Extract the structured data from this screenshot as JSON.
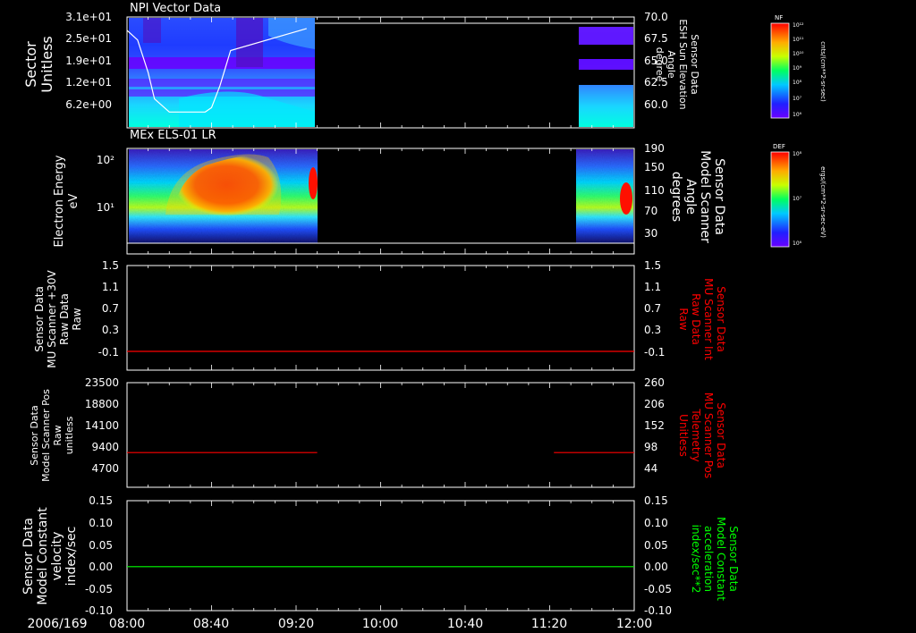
{
  "date_label": "2006/169",
  "x_axis": {
    "start": "08:00",
    "end": "12:00",
    "ticks": [
      "08:00",
      "08:40",
      "09:20",
      "10:00",
      "10:40",
      "11:20",
      "12:00"
    ]
  },
  "panels": [
    {
      "id": "npi",
      "title": "NPI Vector Data",
      "left_label": [
        "Sector",
        "Unitless"
      ],
      "left_ticks": [
        "3.1e+01",
        "2.5e+01",
        "1.9e+01",
        "1.2e+01",
        "6.2e+00"
      ],
      "right_label": [
        "Sensor Data",
        "ESH Sun Elevation",
        "Angle",
        "degree"
      ],
      "right_ticks": [
        "70.0",
        "67.5",
        "65.0",
        "62.5",
        "60.0"
      ],
      "colorbar": {
        "label": "NF",
        "units": "cnts/(cm**2-sr-sec)",
        "ticks": [
          "10¹²",
          "10¹¹",
          "10¹⁰",
          "10⁹",
          "10⁸",
          "10⁷",
          "10⁶"
        ]
      }
    },
    {
      "id": "els",
      "title": "MEx ELS-01 LR",
      "left_label": [
        "Electron Energy",
        "eV"
      ],
      "left_ticks": [
        "10²",
        "10¹"
      ],
      "right_label": [
        "Sensor Data",
        "Model Scanner",
        "Angle",
        "degrees"
      ],
      "right_ticks": [
        "190",
        "150",
        "110",
        "70",
        "30"
      ],
      "colorbar": {
        "label": "DEF",
        "units": "ergs/(cm**2-sr-sec-eV)",
        "ticks": [
          "10⁸",
          "10⁷",
          "10⁶"
        ]
      }
    },
    {
      "id": "mu_raw",
      "left_label": [
        "Sensor Data",
        "MU Scanner +30V",
        "Raw Data",
        "Raw"
      ],
      "left_ticks": [
        "1.5",
        "1.1",
        "0.7",
        "0.3",
        "-0.1"
      ],
      "right_label": [
        "Sensor Data",
        "MU Scanner Int",
        "Raw Data",
        "Raw"
      ],
      "right_ticks": [
        "1.5",
        "1.1",
        "0.7",
        "0.3",
        "-0.1"
      ]
    },
    {
      "id": "scanner_pos",
      "left_label": [
        "Sensor Data",
        "Model Scanner Pos",
        "Raw",
        "unitless"
      ],
      "left_ticks": [
        "23500",
        "18800",
        "14100",
        "9400",
        "4700"
      ],
      "right_label": [
        "Sensor Data",
        "MU Scanner Pos",
        "Telemetry",
        "Unitless"
      ],
      "right_ticks": [
        "260",
        "206",
        "152",
        "98",
        "44"
      ]
    },
    {
      "id": "velocity",
      "left_label": [
        "Sensor Data",
        "Model Constant",
        "velocity",
        "index/sec"
      ],
      "left_ticks": [
        "0.15",
        "0.10",
        "0.05",
        "0.00",
        "-0.05",
        "-0.10"
      ],
      "right_label": [
        "Sensor Data",
        "Model Constant",
        "acceleration",
        "index/sec**2"
      ],
      "right_ticks": [
        "0.15",
        "0.10",
        "0.05",
        "0.00",
        "-0.05",
        "-0.10"
      ]
    }
  ],
  "chart_data": [
    {
      "type": "heatmap",
      "title": "NPI Vector Data",
      "ylabel": "Sector Unitless",
      "y2label": "Sensor Data ESH Sun Elevation Angle degree",
      "xlim": [
        "08:00",
        "12:00"
      ],
      "ylim": [
        0,
        31
      ],
      "y2lim": [
        58.2,
        70.0
      ],
      "data_intervals": [
        [
          "08:00",
          "09:25"
        ],
        [
          "11:26",
          "12:00"
        ]
      ],
      "overlay_line": {
        "name": "ESH Sun Elevation Angle",
        "x": [
          "08:00",
          "08:05",
          "08:10",
          "08:13",
          "08:20",
          "08:30",
          "08:37",
          "08:40",
          "08:44",
          "08:49",
          "09:25"
        ],
        "y": [
          69.3,
          68.2,
          64.5,
          61.5,
          60.0,
          60.0,
          60.0,
          60.5,
          63.0,
          67.0,
          69.5
        ]
      }
    },
    {
      "type": "heatmap",
      "title": "MEx ELS-01 LR",
      "ylabel": "Electron Energy eV",
      "y2label": "Sensor Data Model Scanner Angle degrees",
      "xlim": [
        "08:00",
        "12:00"
      ],
      "yscale": "log",
      "ylim": [
        1,
        160
      ],
      "y2lim": [
        10,
        190
      ],
      "data_intervals": [
        [
          "08:00",
          "09:25"
        ],
        [
          "11:23",
          "12:00"
        ]
      ]
    },
    {
      "type": "line",
      "xlim": [
        "08:00",
        "12:00"
      ],
      "ylim": [
        -0.3,
        1.5
      ],
      "series": [
        {
          "color": "#ff0000",
          "segments": [
            {
              "x": [
                "08:00",
                "12:00"
              ],
              "y": [
                0.0,
                0.0
              ]
            }
          ]
        }
      ]
    },
    {
      "type": "line",
      "xlim": [
        "08:00",
        "12:00"
      ],
      "ylim": [
        0,
        23500
      ],
      "series": [
        {
          "color": "#ff0000",
          "segments": [
            {
              "x": [
                "08:00",
                "09:30"
              ],
              "y": [
                7800,
                7800
              ]
            },
            {
              "x": [
                "11:22",
                "12:00"
              ],
              "y": [
                7800,
                7800
              ]
            }
          ]
        }
      ]
    },
    {
      "type": "line",
      "xlim": [
        "08:00",
        "12:00"
      ],
      "ylim": [
        -0.1,
        0.15
      ],
      "series": [
        {
          "color": "#00ff00",
          "segments": [
            {
              "x": [
                "08:00",
                "12:00"
              ],
              "y": [
                0.0,
                0.0
              ]
            }
          ]
        }
      ]
    }
  ],
  "colors": {
    "axis": "#ffffff",
    "red_label": "#ff0000",
    "green_label": "#00ff00",
    "background": "#000000"
  }
}
